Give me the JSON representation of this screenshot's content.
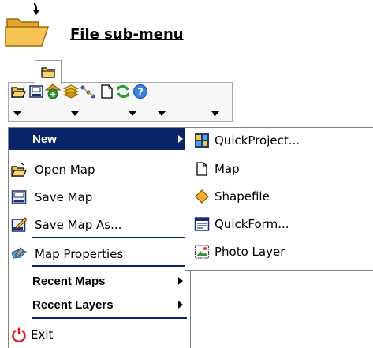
{
  "header": {
    "title": "File sub-menu",
    "icon": "open-folder-icon"
  },
  "toolbar": {
    "tab_icon": "folder-tab-icon",
    "icons": [
      {
        "name": "file-menu-icon",
        "has_dropdown": true
      },
      {
        "name": "save-icon",
        "has_dropdown": false
      },
      {
        "name": "add-layer-icon",
        "has_dropdown": true
      },
      {
        "name": "layers-icon",
        "has_dropdown": false
      },
      {
        "name": "connect-icon",
        "has_dropdown": true
      },
      {
        "name": "document-icon",
        "has_dropdown": true
      },
      {
        "name": "refresh-icon",
        "has_dropdown": false
      },
      {
        "name": "help-icon",
        "has_dropdown": false
      }
    ]
  },
  "menu": {
    "items": [
      {
        "label": "New",
        "icon": null,
        "bold": true,
        "highlighted": true,
        "has_submenu": true
      },
      {
        "label": "Open Map",
        "icon": "open-map-icon"
      },
      {
        "label": "Save Map",
        "icon": "save-map-icon"
      },
      {
        "label": "Save Map As...",
        "icon": "save-map-as-icon"
      },
      {
        "label": "Map Properties",
        "icon": "map-properties-icon"
      },
      {
        "label": "Recent Maps",
        "bold": true,
        "has_submenu": true
      },
      {
        "label": "Recent Layers",
        "bold": true,
        "has_submenu": true
      },
      {
        "label": "Exit",
        "icon": "exit-icon"
      }
    ]
  },
  "submenu": {
    "items": [
      {
        "label": "QuickProject...",
        "icon": "quick-project-icon"
      },
      {
        "label": "Map",
        "icon": "map-document-icon"
      },
      {
        "label": "Shapefile",
        "icon": "shapefile-icon"
      },
      {
        "label": "QuickForm...",
        "icon": "quick-form-icon"
      },
      {
        "label": "Photo Layer",
        "icon": "photo-layer-icon"
      }
    ]
  },
  "colors": {
    "highlight": "#0a246a",
    "highlight_text": "#ffffff",
    "folder_yellow": "#f2c04a",
    "separator": "#0a246a"
  }
}
